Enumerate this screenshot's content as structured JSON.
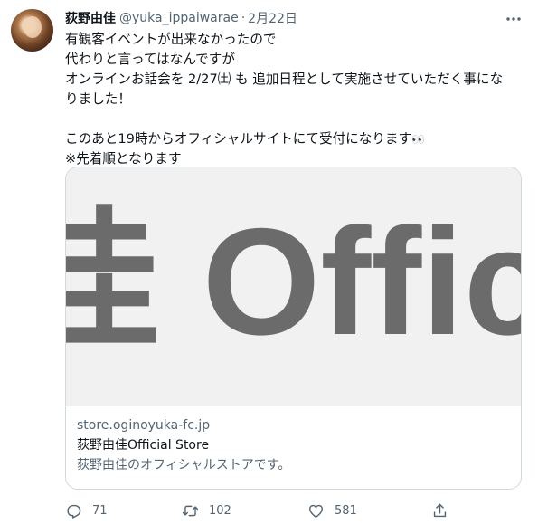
{
  "tweet": {
    "author_name": "荻野由佳",
    "handle": "@yuka_ippaiwarae",
    "separator": "·",
    "date": "2月22日",
    "lines": [
      "有観客イベントが出来なかったので",
      "代わりと言ってはなんですが",
      "オンラインお話会を 2/27㈯ も 追加日程として実施させていただく事にな",
      "りました！",
      "",
      "このあと19時からオフィシャルサイトにて受付になります",
      "※先着順となります"
    ],
    "emoji": "👀"
  },
  "card": {
    "image_text": "佳 Officia",
    "domain": "store.oginoyuka-fc.jp",
    "title": "荻野由佳Official Store",
    "description": "荻野由佳のオフィシャルストアです。"
  },
  "actions": {
    "reply_count": "71",
    "retweet_count": "102",
    "like_count": "581"
  },
  "icons": {
    "more": "more-icon",
    "reply": "reply-icon",
    "retweet": "retweet-icon",
    "like": "heart-icon",
    "share": "share-icon"
  },
  "colors": {
    "text": "#0f1419",
    "secondary": "#536471",
    "border": "#cfd9de",
    "card_logo": "#6b6b6b"
  }
}
